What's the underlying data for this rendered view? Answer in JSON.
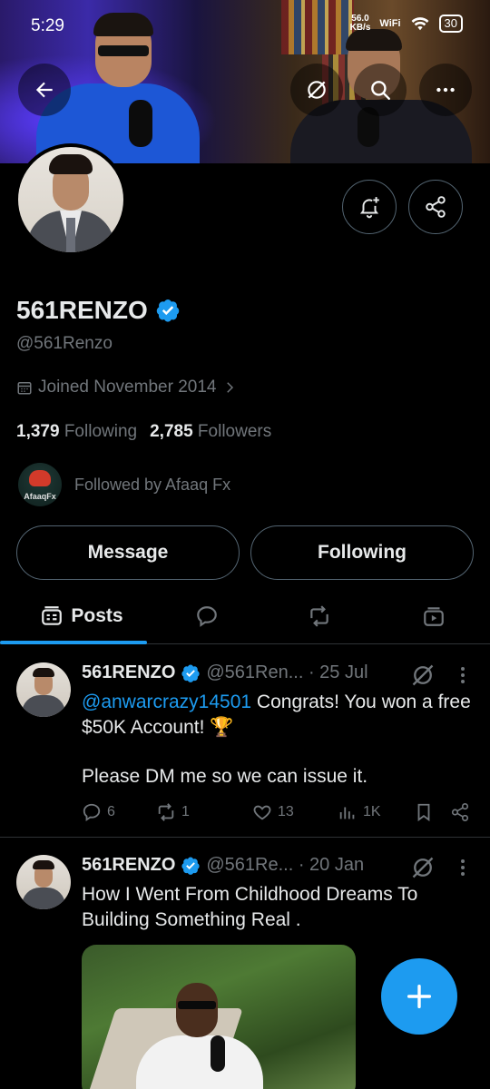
{
  "status_bar": {
    "time": "5:29",
    "net_speed_value": "56.0",
    "net_speed_unit": "KB/s",
    "wifi_label": "WiFi",
    "battery": "30"
  },
  "profile": {
    "display_name": "561RENZO",
    "handle": "@561Renzo",
    "joined": "Joined November 2014",
    "following_count": "1,379",
    "following_label": "Following",
    "followers_count": "2,785",
    "followers_label": "Followers",
    "followed_by": "Followed by Afaaq Fx",
    "followed_by_avatar_text": "AfaaqFx"
  },
  "buttons": {
    "message": "Message",
    "following": "Following"
  },
  "tabs": {
    "posts": "Posts"
  },
  "posts": [
    {
      "name": "561RENZO",
      "meta": "@561Ren... · 25 Jul",
      "mention": "@anwarcrazy14501",
      "text_after_mention": " Congrats! You won a free $50K Account! 🏆",
      "text_line2": "Please DM me so we can issue it.",
      "replies": "6",
      "reposts": "1",
      "likes": "13",
      "views": "1K"
    },
    {
      "name": "561RENZO",
      "meta": "@561Re... · 20 Jan",
      "text": "How I Went From Childhood Dreams To Building Something Real ."
    }
  ],
  "colors": {
    "accent": "#1d9bf0",
    "background": "#000000",
    "muted": "#71767b",
    "text": "#e7e9ea"
  }
}
